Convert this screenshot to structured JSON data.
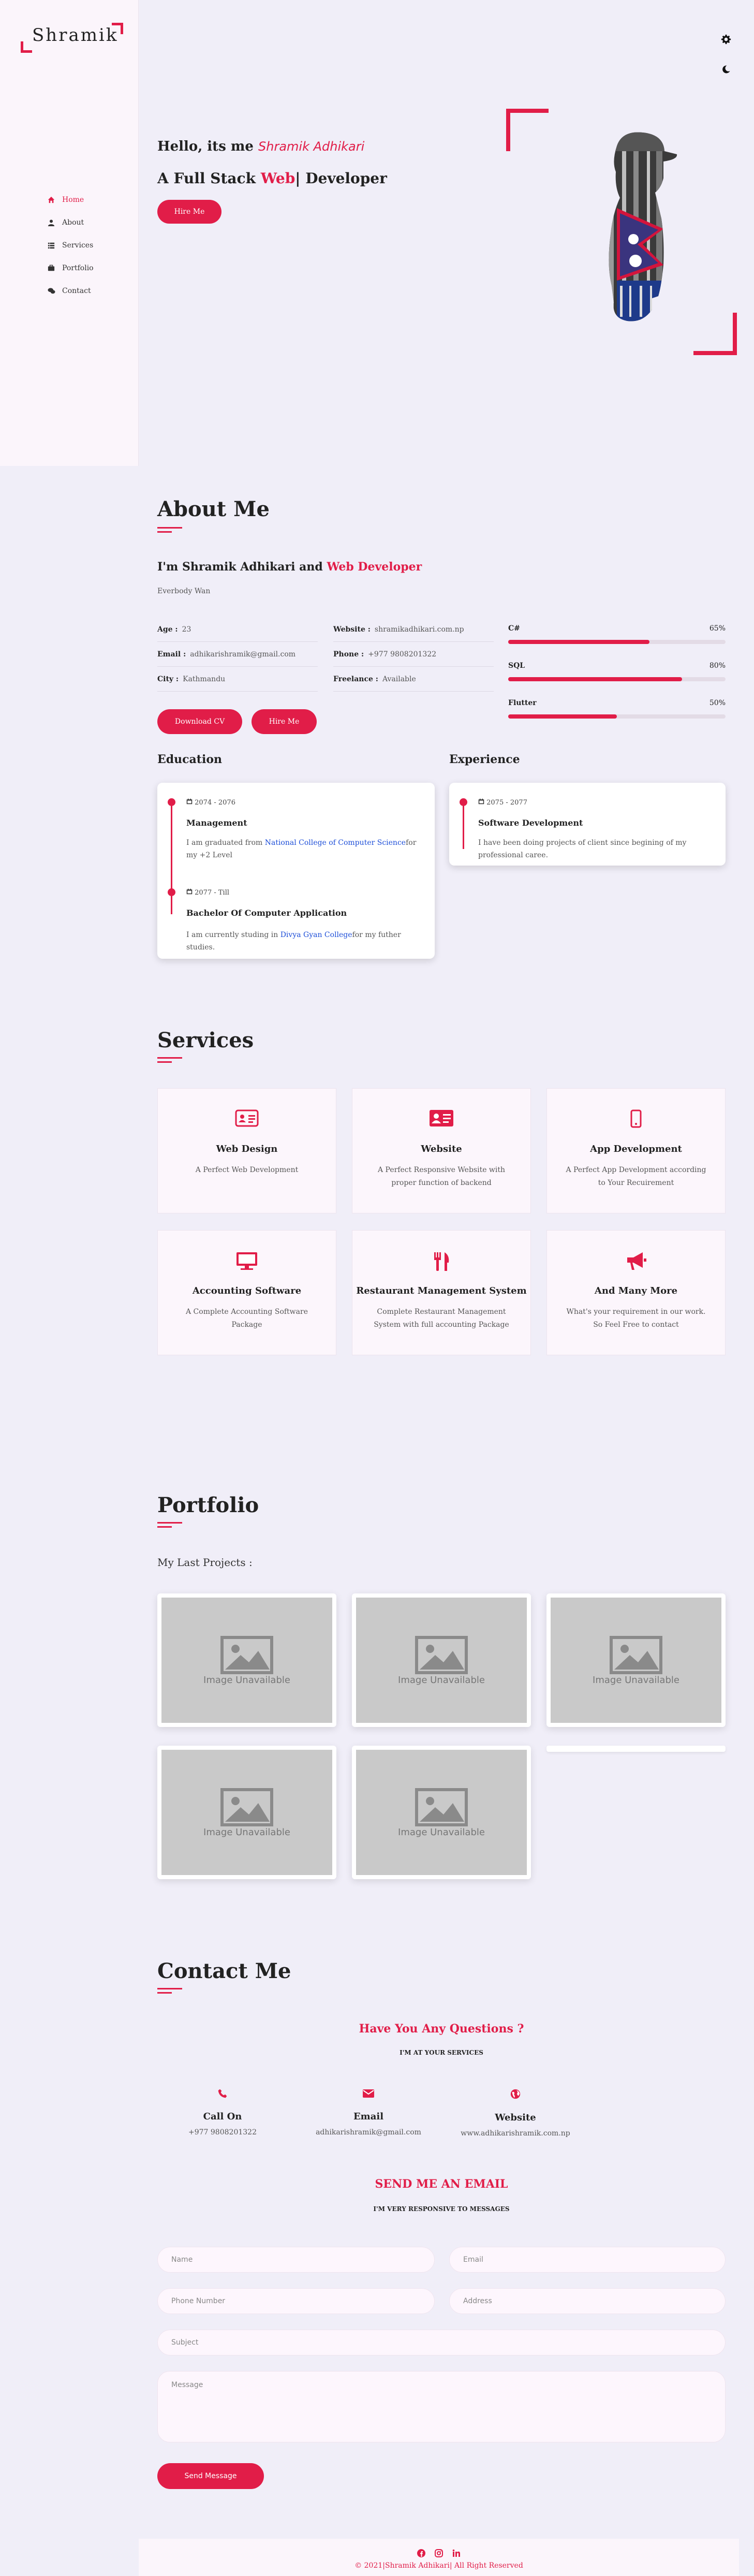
{
  "sidebar": {
    "logo": "Shramik",
    "items": [
      {
        "label": "Home",
        "icon": "home-icon"
      },
      {
        "label": "About",
        "icon": "user-icon"
      },
      {
        "label": "Services",
        "icon": "list-icon"
      },
      {
        "label": "Portfolio",
        "icon": "briefcase-icon"
      },
      {
        "label": "Contact",
        "icon": "chat-icon"
      }
    ]
  },
  "top_icons": [
    "settings-gear-icon",
    "dark-mode-moon-icon"
  ],
  "hero": {
    "hello": "Hello, its me",
    "name": "Shramik Adhikari",
    "role_prefix": "A Full Stack",
    "role_accent": "Web",
    "role_cursor": "|",
    "role_suffix": "Developer",
    "button": "Hire Me"
  },
  "about": {
    "title": "About Me",
    "intro_prefix": "I'm Shramik Adhikari and",
    "intro_accent": "Web Developer",
    "subtitle": "Everbody Wan",
    "info_left": [
      {
        "label": "Age :",
        "value": "23"
      },
      {
        "label": "Email :",
        "value": "adhikarishramik@gmail.com"
      },
      {
        "label": "City :",
        "value": "Kathmandu"
      }
    ],
    "info_right": [
      {
        "label": "Website :",
        "value": "shramikadhikari.com.np"
      },
      {
        "label": "Phone :",
        "value": "+977 9808201322"
      },
      {
        "label": "Freelance :",
        "value": "Available"
      }
    ],
    "skills": [
      {
        "name": "C#",
        "percent": "65%",
        "level": 65
      },
      {
        "name": "SQL",
        "percent": "80%",
        "level": 80
      },
      {
        "name": "Flutter",
        "percent": "50%",
        "level": 50
      }
    ],
    "download_button": "Download CV",
    "hire_button": "Hire Me"
  },
  "education": {
    "title": "Education",
    "items": [
      {
        "date": "2074 - 2076",
        "title": "Management",
        "desc_prefix": "I am graduated from ",
        "desc_link": "National College of Computer Science",
        "desc_suffix": "for my +2 Level"
      },
      {
        "date": "2077 - Till",
        "title": "Bachelor Of Computer Application",
        "desc_prefix": "I am currently studing in ",
        "desc_link": "Divya Gyan College",
        "desc_suffix": "for my futher studies."
      }
    ]
  },
  "experience": {
    "title": "Experience",
    "items": [
      {
        "date": "2075 - 2077",
        "title": "Software Development",
        "desc": "I have been doing projects of client since begining of my professional caree."
      }
    ]
  },
  "services": {
    "title": "Services",
    "items": [
      {
        "icon": "id-card-icon",
        "title": "Web Design",
        "desc": "A Perfect Web Development"
      },
      {
        "icon": "news-card-icon",
        "title": "Website",
        "desc": "A Perfect Responsive Website with proper function of backend"
      },
      {
        "icon": "mobile-icon",
        "title": "App Development",
        "desc": "A Perfect App Development according to Your Recuirement"
      },
      {
        "icon": "desktop-icon",
        "title": "Accounting Software",
        "desc": "A Complete Accounting Software Package"
      },
      {
        "icon": "utensils-icon",
        "title": "Restaurant Management System",
        "desc": "Complete Restaurant Management System with full accounting Package"
      },
      {
        "icon": "megaphone-icon",
        "title": "And Many More",
        "desc": "What's your requirement in our work. So Feel Free to contact"
      }
    ]
  },
  "portfolio": {
    "title": "Portfolio",
    "subtitle": "My Last Projects :",
    "placeholder_text": "Image Unavailable",
    "count": 5
  },
  "contact": {
    "title": "Contact Me",
    "question": "Have You Any Questions ?",
    "at_service": "I'M AT YOUR SERVICES",
    "items": [
      {
        "icon": "phone-icon",
        "title": "Call On",
        "value": "+977 9808201322"
      },
      {
        "icon": "envelope-icon",
        "title": "Email",
        "value": "adhikarishramik@gmail.com"
      },
      {
        "icon": "globe-icon",
        "title": "Website",
        "value": "www.adhikarishramik.com.np"
      }
    ],
    "send_email": "SEND ME AN EMAIL",
    "responsive": "I'M VERY RESPONSIVE TO MESSAGES",
    "form": {
      "name": "Name",
      "email": "Email",
      "phone": "Phone Number",
      "address": "Address",
      "subject": "Subject",
      "message": "Message",
      "submit": "Send Message"
    }
  },
  "footer": {
    "socials": [
      "facebook-icon",
      "instagram-icon",
      "linkedin-icon"
    ],
    "copyright": "© 2021|Shramik Adhikari| All Right Reserved"
  },
  "colors": {
    "accent": "#e11d48",
    "background": "#f0eef8",
    "sidebar": "#fbf5fb"
  }
}
